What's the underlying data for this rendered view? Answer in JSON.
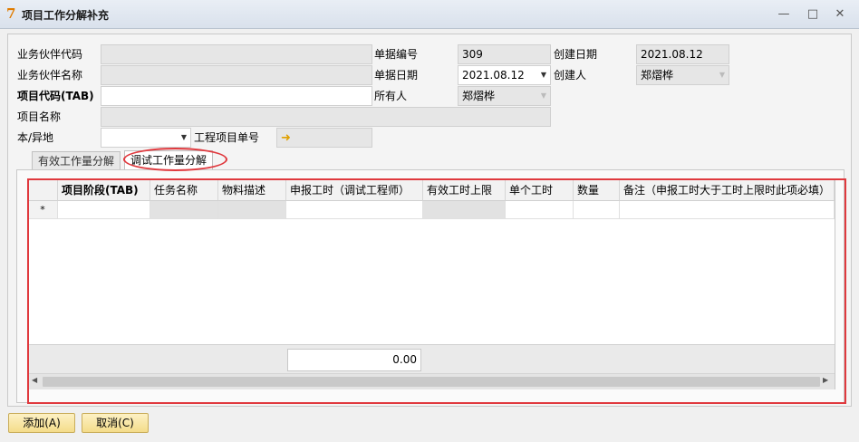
{
  "window": {
    "title": "项目工作分解补充",
    "icon": "app-logo-icon",
    "controls": [
      "minimize-icon",
      "maximize-icon",
      "close-icon"
    ]
  },
  "form": {
    "partner_code_label": "业务伙伴代码",
    "partner_name_label": "业务伙伴名称",
    "project_code_label": "项目代码(TAB)",
    "project_name_label": "项目名称",
    "local_remote_label": "本/异地",
    "doc_number_label": "单据编号",
    "doc_number_value": "309",
    "doc_date_label": "单据日期",
    "doc_date_value": "2021.08.12",
    "owner_label": "所有人",
    "owner_value": "郑熠桦",
    "create_date_label": "创建日期",
    "create_date_value": "2021.08.12",
    "creator_label": "创建人",
    "creator_value": "郑熠桦",
    "project_order_label": "工程项目单号"
  },
  "tabs": [
    {
      "label": "有效工作量分解",
      "active": false
    },
    {
      "label": "调试工作量分解",
      "active": true
    }
  ],
  "grid": {
    "columns": [
      "项目阶段(TAB)",
      "任务名称",
      "物料描述",
      "申报工时（调试工程师）",
      "有效工时上限",
      "单个工时",
      "数量",
      "备注（申报工时大于工时上限时此项必填）"
    ],
    "new_row_marker": "*",
    "total_value": "0.00"
  },
  "buttons": {
    "add": "添加(A)",
    "cancel": "取消(C)"
  },
  "colors": {
    "highlight": "#e0393e",
    "button_bg": "#f4dc8a",
    "readonly_field": "#e6e6e6"
  }
}
